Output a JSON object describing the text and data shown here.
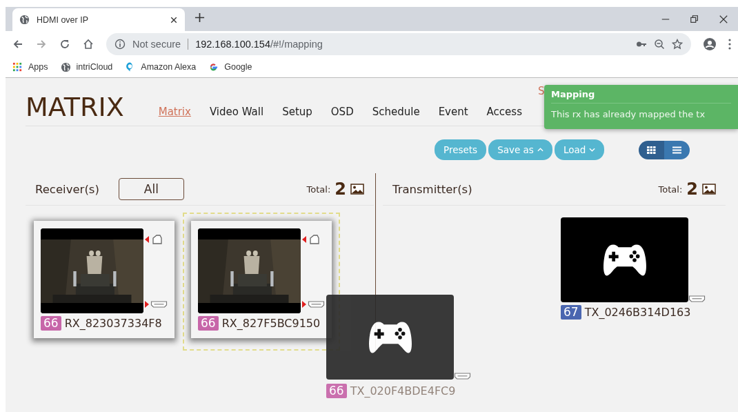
{
  "browser": {
    "tab": {
      "title": "HDMI over IP"
    },
    "address": {
      "security": "Not secure",
      "host": "192.168.100.154",
      "path": "/#!/mapping"
    },
    "bookmarks": [
      {
        "label": "Apps",
        "kind": "apps"
      },
      {
        "label": "intriCloud",
        "kind": "globe"
      },
      {
        "label": "Amazon Alexa",
        "kind": "pin"
      },
      {
        "label": "Google",
        "kind": "google"
      }
    ]
  },
  "app": {
    "logo": "MATRIX",
    "partial_link": "S",
    "nav": [
      {
        "label": "Matrix",
        "selected": true
      },
      {
        "label": "Video Wall",
        "selected": false
      },
      {
        "label": "Setup",
        "selected": false
      },
      {
        "label": "OSD",
        "selected": false
      },
      {
        "label": "Schedule",
        "selected": false
      },
      {
        "label": "Event",
        "selected": false
      },
      {
        "label": "Access",
        "selected": false
      }
    ],
    "toast": {
      "title": "Mapping",
      "message": "This rx has already mapped the tx"
    },
    "toolbar": {
      "buttons": [
        {
          "label": "Presets",
          "kind": "plain"
        },
        {
          "label": "Save as",
          "kind": "up"
        },
        {
          "label": "Load",
          "kind": "down"
        }
      ],
      "views": [
        {
          "kind": "grid",
          "selected": true
        },
        {
          "kind": "list",
          "selected": false
        }
      ]
    },
    "receivers": {
      "title": "Receiver(s)",
      "filter": "All",
      "total_label": "Total:",
      "total": "2",
      "cards": [
        {
          "badge": "66",
          "color": "#c766a9",
          "name": "RX_823037334F8",
          "kind": "picture",
          "highlighted": false
        },
        {
          "badge": "66",
          "color": "#c766a9",
          "name": "RX_827F5BC9150",
          "kind": "picture",
          "highlighted": true
        }
      ]
    },
    "transmitters": {
      "title": "Transmitter(s)",
      "total_label": "Total:",
      "total": "2",
      "cards": [
        {
          "badge": "67",
          "color": "#4a66b0",
          "name": "TX_0246B314D163",
          "kind": "gamepad",
          "highlighted": false
        }
      ]
    },
    "dragged": {
      "badge": "66",
      "color": "#c766a9",
      "name": "TX_020F4BDE4FC9",
      "kind": "gamepad"
    }
  }
}
